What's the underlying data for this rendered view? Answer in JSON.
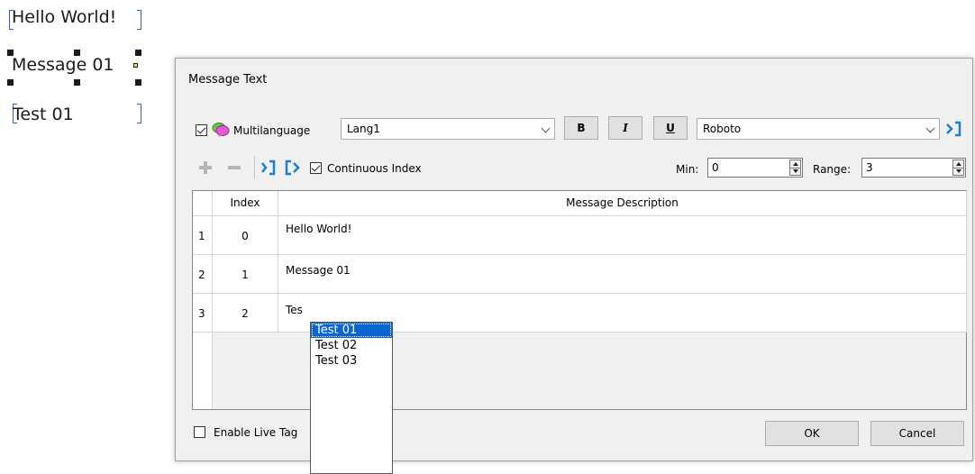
{
  "canvas": {
    "items": [
      {
        "text": "Hello World!"
      },
      {
        "text": "Message 01"
      },
      {
        "text": "Test 01"
      }
    ]
  },
  "dialog": {
    "title": "Message Text",
    "multilanguage": {
      "label": "Multilanguage",
      "checked": true
    },
    "language_combo": {
      "value": "Lang1"
    },
    "format": {
      "bold": "B",
      "italic": "I",
      "underline": "U"
    },
    "font_combo": {
      "value": "Roboto"
    },
    "toolbar": {
      "continuous_index": {
        "label": "Continuous Index",
        "checked": true
      },
      "min_label": "Min:",
      "min_value": "0",
      "range_label": "Range:",
      "range_value": "3"
    },
    "table": {
      "columns": [
        "Index",
        "Message Description"
      ],
      "rows": [
        {
          "row_number": "1",
          "index": "0",
          "description": "Hello World!"
        },
        {
          "row_number": "2",
          "index": "1",
          "description": "Message 01"
        },
        {
          "row_number": "3",
          "index": "2",
          "description": "Tes"
        }
      ]
    },
    "enable_live_tag": {
      "label": "Enable Live Tag",
      "checked": false
    },
    "ok_label": "OK",
    "cancel_label": "Cancel"
  },
  "autocomplete": {
    "items": [
      "Test 01",
      "Test 02",
      "Test 03"
    ],
    "selected": "Test 01"
  },
  "colors": {
    "accent": "#0a64d6",
    "selection_bracket": "#2f5fb0",
    "link_icon": "#1a7fd4"
  }
}
